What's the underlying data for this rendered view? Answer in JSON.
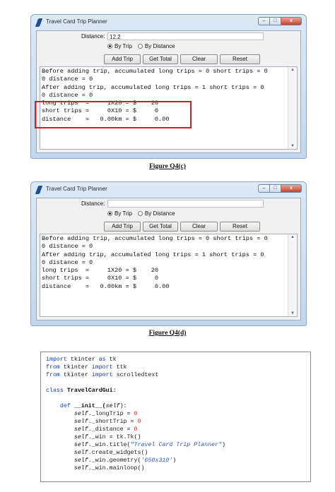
{
  "window1": {
    "title": "Travel Card Trip Planner",
    "title_buttons": {
      "minimize": "–",
      "maximize": "□",
      "close": "x"
    },
    "distance_label": "Distance:",
    "distance_value": "12.2",
    "radio_by_trip": "By Trip",
    "radio_by_distance": "By Distance",
    "selected_radio": "By Trip",
    "buttons": {
      "add_trip": "Add Trip",
      "get_total": "Get Total",
      "clear": "Clear",
      "reset": "Reset"
    },
    "text_lines": [
      "Before adding trip, accumulated long trips = 0 short trips = 0",
      "0 distance = 0",
      "After adding trip, accumulated long trips = 1 short trips = 0",
      "0 distance = 0",
      "long trips  =     1X20 = $    20",
      "short trips =     0X10 = $     0",
      "distance    =   0.00km = $     0.00"
    ]
  },
  "caption1": "Figure Q4(c)",
  "window2": {
    "title": "Travel Card Trip Planner",
    "title_buttons": {
      "minimize": "–",
      "maximize": "□",
      "close": "x"
    },
    "distance_label": "Distance:",
    "distance_value": "",
    "radio_by_trip": "By Trip",
    "radio_by_distance": "By Distance",
    "selected_radio": "By Trip",
    "buttons": {
      "add_trip": "Add Trip",
      "get_total": "Get Total",
      "clear": "Clear",
      "reset": "Reset"
    },
    "text_lines": [
      "Before adding trip, accumulated long trips = 0 short trips = 0",
      "0 distance = 0",
      "After adding trip, accumulated long trips = 1 short trips = 0",
      "0 distance = 0",
      "long trips  =     1X20 = $    20",
      "short trips =     0X10 = $     0",
      "distance    =   0.00km = $     0.00"
    ]
  },
  "caption2": "Figure Q4(d)",
  "code": {
    "l1": {
      "a": "import",
      "b": " tkinter ",
      "c": "as",
      "d": " tk"
    },
    "l2": {
      "a": "from",
      "b": " tkinter ",
      "c": "import",
      "d": " ttk"
    },
    "l3": {
      "a": "from",
      "b": " tkinter ",
      "c": "import",
      "d": " scrolledtext"
    },
    "l5": {
      "a": "class",
      "b": " TravelCardGui:"
    },
    "l7": {
      "a": "    def",
      "b": " __init__(",
      "c": "self",
      "d": "):"
    },
    "l8": {
      "a": "self",
      "b": "._longTrip = ",
      "c": "0"
    },
    "l9": {
      "a": "self",
      "b": "._shortTrip = ",
      "c": "0"
    },
    "l10": {
      "a": "self",
      "b": "._distance = ",
      "c": "0"
    },
    "l11": {
      "a": "self",
      "b": "._win = tk.Tk()"
    },
    "l12": {
      "a": "self",
      "b": "._win.title(",
      "c": "\"Travel Card Trip Planner\"",
      "d": ")"
    },
    "l13": {
      "a": "self",
      "b": ".create_widgets()"
    },
    "l14": {
      "a": "self",
      "b": "._win.geometry(",
      "c": "'650x310'",
      "d": ")"
    },
    "l15": {
      "a": "self",
      "b": "._win.mainloop()"
    }
  }
}
